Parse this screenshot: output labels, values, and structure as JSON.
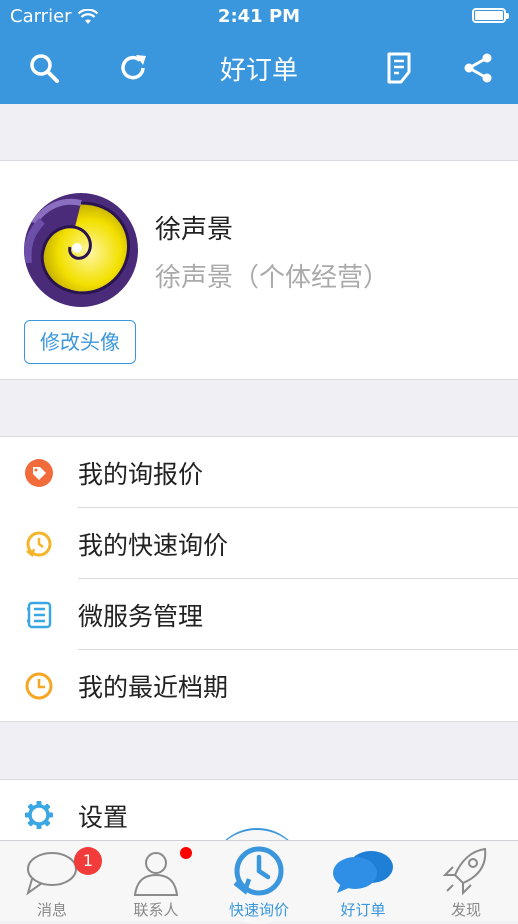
{
  "status_bar": {
    "carrier": "Carrier",
    "time": "2:41 PM"
  },
  "nav": {
    "title": "好订单",
    "icons": [
      "search-icon",
      "refresh-icon",
      "note-icon",
      "share-icon"
    ]
  },
  "profile": {
    "name": "徐声景",
    "company": "徐声景（个体经营）",
    "edit_avatar_label": "修改头像"
  },
  "menu": {
    "items": [
      {
        "label": "我的询报价",
        "icon": "price-tag-icon",
        "color": "#f26b3a"
      },
      {
        "label": "我的快速询价",
        "icon": "quick-inquiry-icon",
        "color": "#f5b52a"
      },
      {
        "label": "微服务管理",
        "icon": "list-icon",
        "color": "#3aa7e2"
      },
      {
        "label": "我的最近档期",
        "icon": "clock-icon",
        "color": "#f5a623"
      }
    ],
    "settings_label": "设置"
  },
  "tabbar": {
    "tabs": [
      {
        "label": "消息",
        "icon": "message-icon",
        "badge": "1"
      },
      {
        "label": "联系人",
        "icon": "contacts-icon"
      },
      {
        "label": "快速询价",
        "icon": "quick-inquiry-icon"
      },
      {
        "label": "好订单",
        "icon": "chat-icon"
      },
      {
        "label": "发现",
        "icon": "rocket-icon"
      }
    ],
    "active": "好订单"
  },
  "colors": {
    "primary": "#3a97dd",
    "badge": "#f23b3b"
  }
}
